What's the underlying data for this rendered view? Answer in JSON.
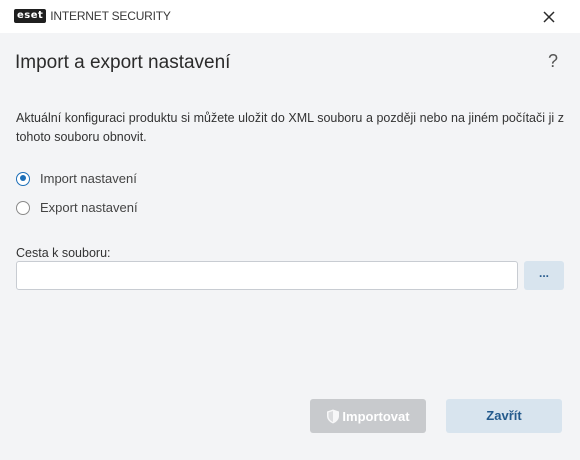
{
  "titlebar": {
    "logo_text": "eset",
    "product_name": "INTERNET SECURITY",
    "close_icon": "close-icon"
  },
  "header": {
    "title": "Import a export nastavení",
    "help_label": "?"
  },
  "description": "Aktuální konfiguraci produktu si můžete uložit do XML souboru a později nebo na jiném počítači ji z tohoto souboru obnovit.",
  "options": [
    {
      "label": "Import nastavení",
      "checked": true
    },
    {
      "label": "Export nastavení",
      "checked": false
    }
  ],
  "path": {
    "label": "Cesta k souboru:",
    "value": "",
    "placeholder": "",
    "browse_label": "..."
  },
  "footer": {
    "import_label": "Importovat",
    "import_enabled": false,
    "import_icon": "shield-icon",
    "close_label": "Zavřít"
  },
  "colors": {
    "accent": "#1d6fb8",
    "button_secondary_bg": "#d8e4ee",
    "button_disabled_bg": "#c8cacd",
    "window_bg": "#f3f4f6"
  }
}
